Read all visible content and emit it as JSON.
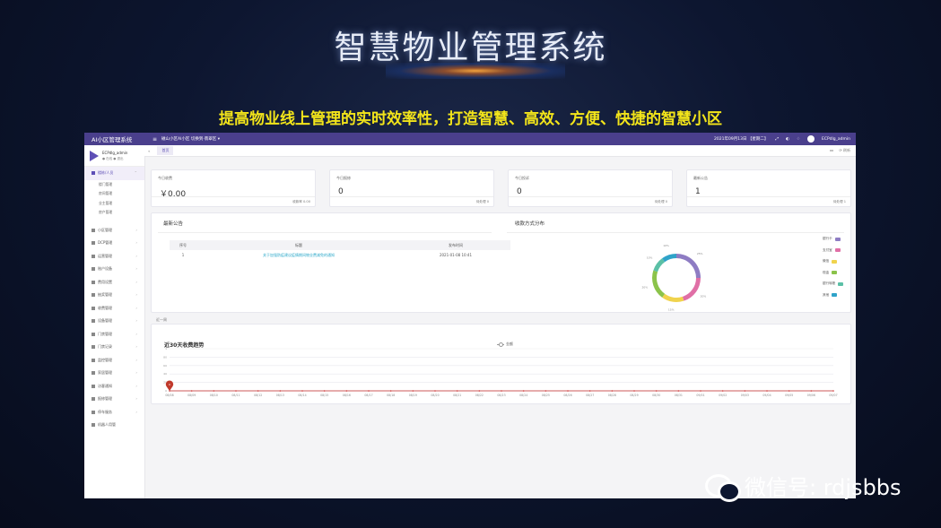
{
  "slide": {
    "title": "智慧物业管理系统",
    "subtitle": "提高物业线上管理的实时效率性，打造智慧、高效、方便、快捷的智慧小区",
    "watermark": "微信号: rdjsbbs"
  },
  "app": {
    "brand": "AI小区管理系统",
    "community_selector": "磁山小区AI小区 切换到·翡翠区 ▾",
    "datetime": "2021年09月13日 【星期二】",
    "user": "ECPdlg_admin",
    "sidebar": {
      "user_name": "ECPdlg_admin",
      "user_status": "● 在线  ● 退出",
      "items": [
        {
          "label": "楼栋/人员",
          "active": true
        },
        {
          "label": "小区管理"
        },
        {
          "label": "DCP管理"
        },
        {
          "label": "运营管理"
        },
        {
          "label": "账户设备"
        },
        {
          "label": "费用设置"
        },
        {
          "label": "抽奖管理"
        },
        {
          "label": "收费管理"
        },
        {
          "label": "设备管理"
        },
        {
          "label": "门禁管理"
        },
        {
          "label": "门禁记录"
        },
        {
          "label": "监控管理"
        },
        {
          "label": "家居管理"
        },
        {
          "label": "访客通知"
        },
        {
          "label": "报修管理"
        },
        {
          "label": "停车服务"
        },
        {
          "label": "机器人用管"
        }
      ],
      "sub_items": [
        "楼门管理",
        "房间管理",
        "业主管理",
        "房户管理"
      ]
    },
    "tabs": {
      "home": "首页",
      "right_1": "▸▸",
      "right_2": "⟳ 刷新"
    },
    "stats": [
      {
        "label": "今日收费",
        "value": "￥0.00",
        "foot": "收款率   0.00"
      },
      {
        "label": "今日报修",
        "value": "0",
        "foot": "待处理   0"
      },
      {
        "label": "今日投诉",
        "value": "0",
        "foot": "待处理   0"
      },
      {
        "label": "最新公告",
        "value": "1",
        "foot": "待处理   1"
      }
    ],
    "announcements": {
      "title": "最新公告",
      "columns": [
        "序号",
        "标题",
        "发布时间"
      ],
      "rows": [
        [
          "1",
          "关于加强防疫建议疫情期间物业费减免的通知",
          "2021-01-08 10:41"
        ]
      ]
    },
    "section_label": "近一周",
    "colors": {
      "topbar": "#4a3f8c",
      "accent": "#5e4fb6",
      "link": "#29a7c9"
    }
  },
  "chart_data": [
    {
      "type": "pie",
      "title": "收款方式分布",
      "donut": true,
      "labels": [
        "银行卡",
        "支付宝",
        "微信",
        "现金",
        "银行转账",
        "其他"
      ],
      "values": [
        25,
        20,
        15,
        20,
        10,
        10
      ],
      "colors": [
        "#8e7cc3",
        "#e06fa6",
        "#f0d34d",
        "#8bc34a",
        "#5bc0a6",
        "#2fa3c9"
      ],
      "legend": "right"
    },
    {
      "type": "line",
      "title": "近30天收费趋势",
      "series": [
        {
          "name": "金额",
          "values": [
            0,
            0,
            0,
            0,
            0,
            0,
            0,
            0,
            0,
            0,
            0,
            0,
            0,
            0,
            0,
            0,
            0,
            0,
            0,
            0,
            0,
            0,
            0,
            0,
            0,
            0,
            0,
            0,
            0,
            0,
            0
          ]
        }
      ],
      "x": [
        "08/08",
        "08/09",
        "08/10",
        "08/11",
        "08/12",
        "08/13",
        "08/14",
        "08/15",
        "08/16",
        "08/17",
        "08/18",
        "08/19",
        "08/20",
        "08/21",
        "08/22",
        "08/23",
        "08/24",
        "08/25",
        "08/26",
        "08/27",
        "08/28",
        "08/29",
        "08/30",
        "08/31",
        "09/01",
        "09/02",
        "09/03",
        "09/04",
        "09/05",
        "09/06",
        "09/07"
      ],
      "yticks": [
        "0",
        "20",
        "40",
        "60",
        "80",
        "1"
      ],
      "ylim": [
        0,
        1
      ],
      "marker_label": "0",
      "grid": true
    }
  ]
}
